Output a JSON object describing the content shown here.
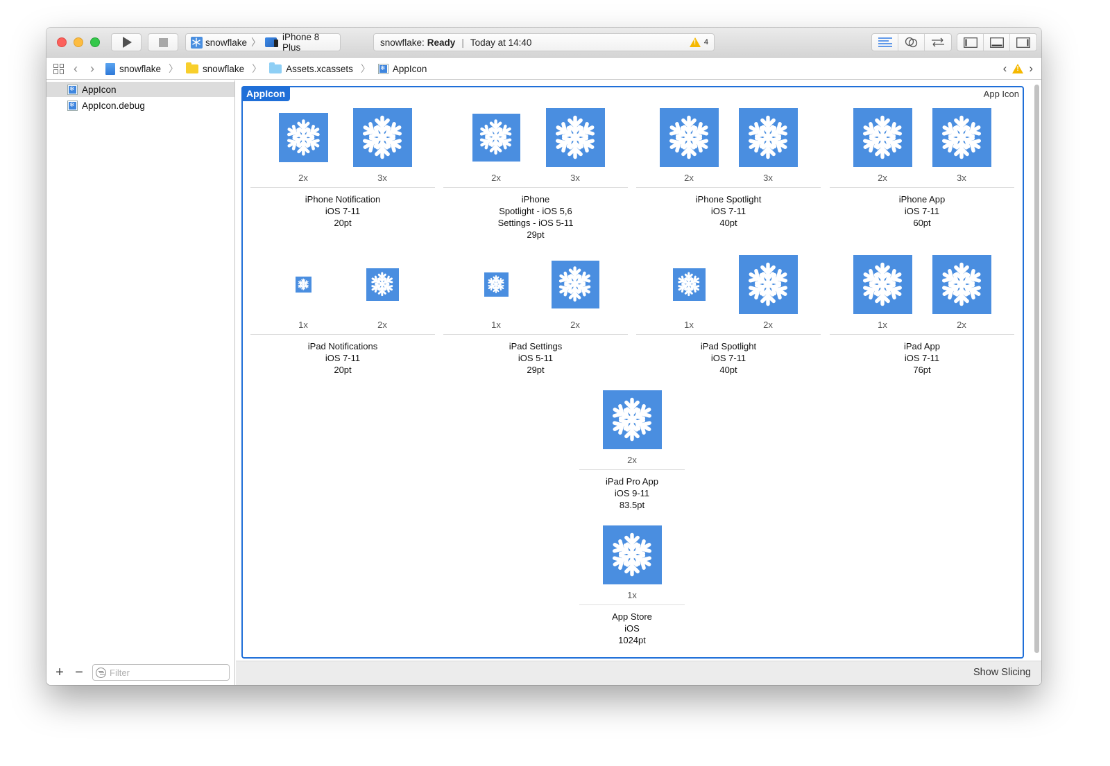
{
  "window": {
    "toolbar": {
      "scheme_target": "snowflake",
      "scheme_device": "iPhone 8 Plus",
      "activity_project": "snowflake:",
      "activity_status": "Ready",
      "activity_time": "Today at 14:40",
      "warning_count": "4"
    },
    "jumpbar": {
      "crumbs": [
        "snowflake",
        "snowflake",
        "Assets.xcassets",
        "AppIcon"
      ]
    },
    "sidebar": {
      "items": [
        {
          "label": "AppIcon",
          "selected": true
        },
        {
          "label": "AppIcon.debug",
          "selected": false
        }
      ],
      "filter_placeholder": "Filter"
    },
    "editor": {
      "set_name": "AppIcon",
      "set_type": "App Icon",
      "show_slicing": "Show Slicing",
      "groups": [
        {
          "lines": [
            "iPhone Notification",
            "iOS 7-11",
            "20pt"
          ],
          "slots": [
            "2x",
            "3x"
          ]
        },
        {
          "lines": [
            "iPhone",
            "Spotlight - iOS 5,6",
            "Settings - iOS 5-11",
            "29pt"
          ],
          "slots": [
            "2x",
            "3x"
          ]
        },
        {
          "lines": [
            "iPhone Spotlight",
            "iOS 7-11",
            "40pt"
          ],
          "slots": [
            "2x",
            "3x"
          ]
        },
        {
          "lines": [
            "iPhone App",
            "iOS 7-11",
            "60pt"
          ],
          "slots": [
            "2x",
            "3x"
          ]
        },
        {
          "lines": [
            "iPad Notifications",
            "iOS 7-11",
            "20pt"
          ],
          "slots": [
            "1x",
            "2x"
          ]
        },
        {
          "lines": [
            "iPad Settings",
            "iOS 5-11",
            "29pt"
          ],
          "slots": [
            "1x",
            "2x"
          ]
        },
        {
          "lines": [
            "iPad Spotlight",
            "iOS 7-11",
            "40pt"
          ],
          "slots": [
            "1x",
            "2x"
          ]
        },
        {
          "lines": [
            "iPad App",
            "iOS 7-11",
            "76pt"
          ],
          "slots": [
            "1x",
            "2x"
          ]
        },
        {
          "lines": [
            "iPad Pro App",
            "iOS 9-11",
            "83.5pt"
          ],
          "slots": [
            "2x"
          ]
        },
        {
          "lines": [
            "App Store",
            "iOS",
            "1024pt"
          ],
          "slots": [
            "1x"
          ]
        }
      ]
    }
  },
  "colors": {
    "accent": "#1f6fd8",
    "icon_blue": "#4a8ee0",
    "warning": "#f5b800"
  }
}
